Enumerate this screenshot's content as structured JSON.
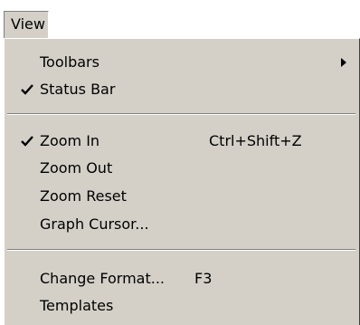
{
  "menubar": {
    "title": "View"
  },
  "menu": {
    "toolbars": {
      "label": "Toolbars",
      "submenu_arrow": "chevron-right-icon"
    },
    "status_bar": {
      "label": "Status Bar",
      "checked": true
    },
    "zoom_in": {
      "label": "Zoom In",
      "shortcut": "Ctrl+Shift+Z",
      "checked": true
    },
    "zoom_out": {
      "label": "Zoom Out"
    },
    "zoom_reset": {
      "label": "Zoom Reset"
    },
    "graph_cursor": {
      "label": "Graph Cursor..."
    },
    "change_format": {
      "label": "Change Format...",
      "shortcut": "F3"
    },
    "templates": {
      "label": "Templates"
    }
  },
  "colors": {
    "menu_background": "#d4d0c8",
    "text": "#000000",
    "separator_dark": "#808080",
    "separator_light": "#ffffff"
  }
}
